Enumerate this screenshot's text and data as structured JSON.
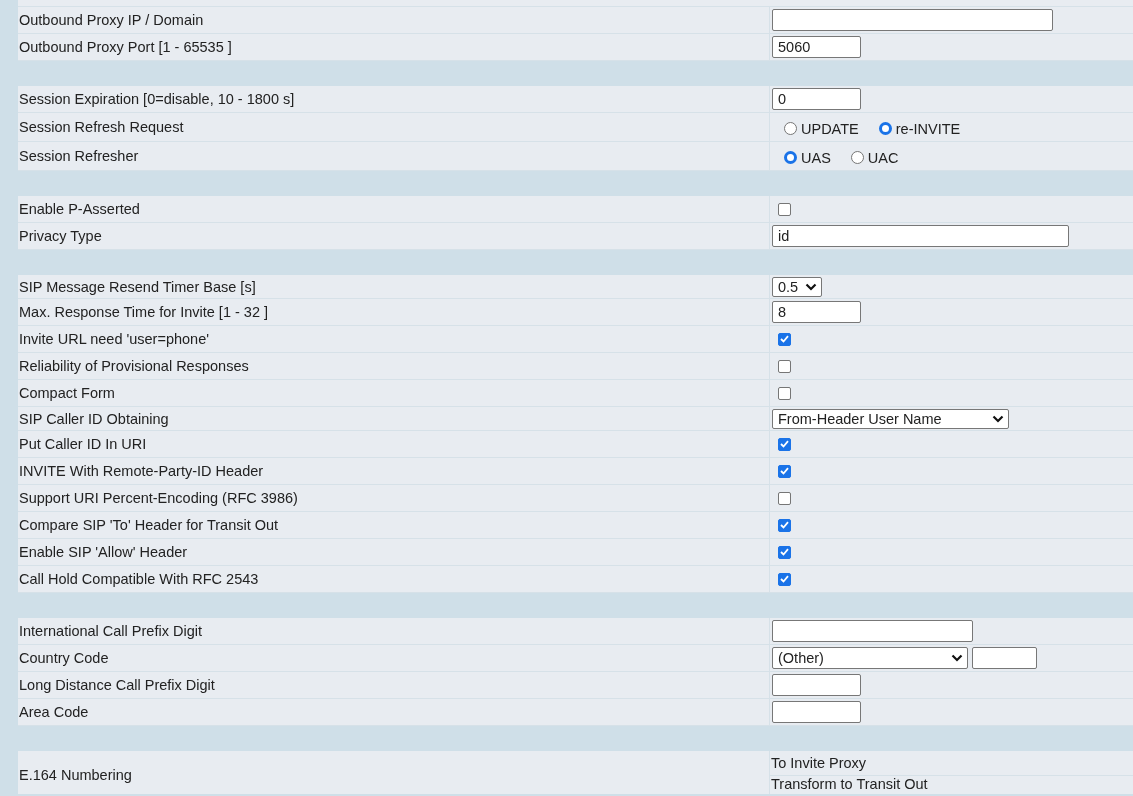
{
  "sections": [
    {
      "rows": [
        {
          "kind": "long_field",
          "label": "Outbound Proxy IP / Domain"
        },
        {
          "kind": "short_field",
          "label": "Outbound Proxy Port [1 - 65535 ]",
          "value": "5060"
        }
      ]
    },
    {
      "rows": [
        {
          "kind": "short_field",
          "label": "Session Expiration [0=disable, 10 - 1800 s]",
          "value": "0"
        },
        {
          "kind": "radio",
          "label": "Session Refresh Request",
          "options": [
            {
              "label": "UPDATE",
              "selected": false
            },
            {
              "label": "re-INVITE",
              "selected": true
            }
          ]
        },
        {
          "kind": "radio",
          "label": "Session Refresher",
          "options": [
            {
              "label": "UAS",
              "selected": true
            },
            {
              "label": "UAC",
              "selected": false
            }
          ]
        }
      ]
    },
    {
      "rows": [
        {
          "kind": "checkbox",
          "label": "Enable P-Asserted",
          "checked": false
        },
        {
          "kind": "wide_field",
          "label": "Privacy Type",
          "value": "id"
        }
      ]
    },
    {
      "rows": [
        {
          "kind": "small_select",
          "label": "SIP Message Resend Timer Base [s]",
          "value": "0.5"
        },
        {
          "kind": "short_field",
          "label": "Max. Response Time for Invite [1 - 32 ]",
          "value": "8"
        },
        {
          "kind": "checkbox",
          "label": "Invite URL need 'user=phone'",
          "checked": true
        },
        {
          "kind": "checkbox",
          "label": "Reliability of Provisional Responses",
          "checked": false
        },
        {
          "kind": "checkbox",
          "label": "Compact Form",
          "checked": false
        },
        {
          "kind": "wide_select",
          "label": "SIP Caller ID Obtaining",
          "value": "From-Header User Name"
        },
        {
          "kind": "checkbox",
          "label": "Put Caller ID In URI",
          "checked": true
        },
        {
          "kind": "checkbox",
          "label": "INVITE With Remote-Party-ID Header",
          "checked": true
        },
        {
          "kind": "checkbox",
          "label": "Support URI Percent-Encoding (RFC 3986)",
          "checked": false
        },
        {
          "kind": "checkbox",
          "label": "Compare SIP 'To' Header for Transit Out",
          "checked": true
        },
        {
          "kind": "checkbox",
          "label": "Enable SIP 'Allow' Header",
          "checked": true
        },
        {
          "kind": "checkbox",
          "label": "Call Hold Compatible With RFC 2543",
          "checked": true
        }
      ]
    },
    {
      "rows": [
        {
          "kind": "medium_field",
          "label": "International Call Prefix Digit"
        },
        {
          "kind": "select_with_field",
          "label": "Country Code",
          "value": "(Other)"
        },
        {
          "kind": "short_field",
          "label": "Long Distance Call Prefix Digit"
        },
        {
          "kind": "short_field",
          "label": "Area Code"
        }
      ]
    }
  ],
  "e164": {
    "label": "E.164 Numbering",
    "options": [
      "To Invite Proxy",
      "Transform to Transit Out"
    ]
  }
}
